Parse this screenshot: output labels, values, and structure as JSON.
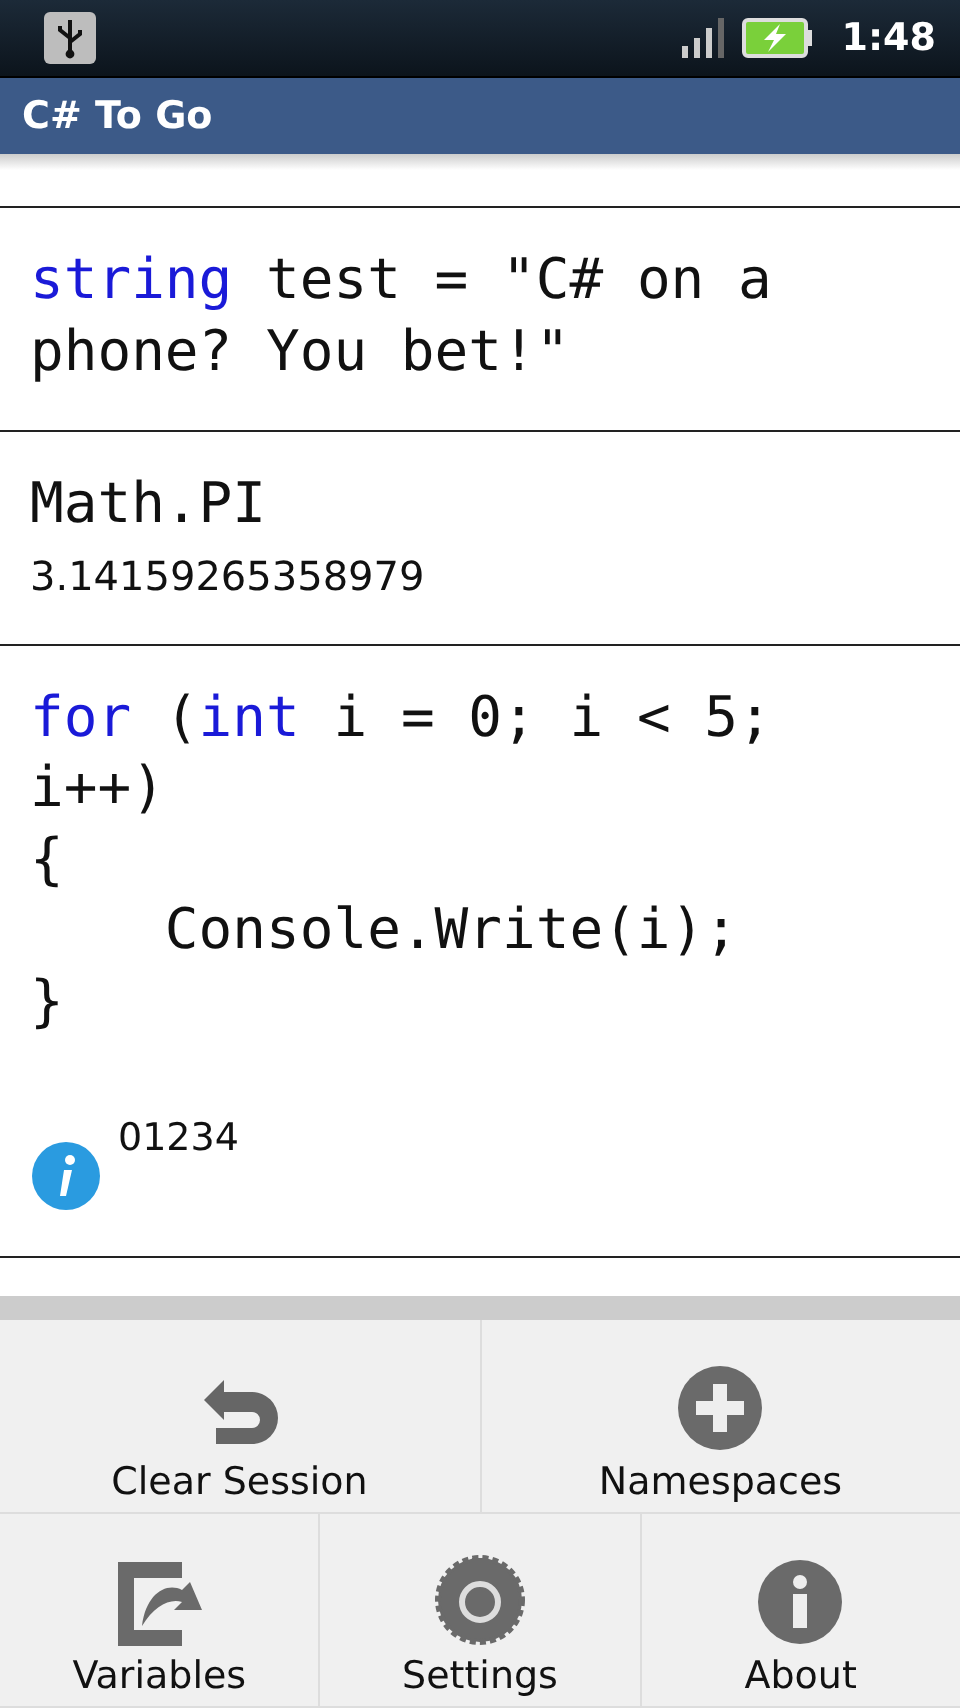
{
  "status_bar": {
    "time": "1:48"
  },
  "window": {
    "title": "C# To Go"
  },
  "entries": [
    {
      "code": [
        [
          {
            "text": "string",
            "kind": "keyword"
          },
          {
            "text": " test = \"C# on a",
            "kind": "plain"
          }
        ],
        [
          {
            "text": "phone? You bet!\"",
            "kind": "plain"
          }
        ]
      ]
    },
    {
      "code": [
        [
          {
            "text": "Math.PI",
            "kind": "plain"
          }
        ]
      ],
      "result": {
        "kind": "value",
        "text": "3.14159265358979"
      }
    },
    {
      "code": [
        [
          {
            "text": "for",
            "kind": "keyword"
          },
          {
            "text": " (",
            "kind": "plain"
          },
          {
            "text": "int",
            "kind": "keyword"
          },
          {
            "text": " i = 0; i < 5;",
            "kind": "plain"
          }
        ],
        [
          {
            "text": "i++)",
            "kind": "plain"
          }
        ],
        [
          {
            "text": "{",
            "kind": "plain"
          }
        ],
        [
          {
            "text": "    Console.Write(i);",
            "kind": "plain"
          }
        ],
        [
          {
            "text": "}",
            "kind": "plain"
          }
        ]
      ],
      "result": {
        "kind": "info",
        "text": "01234"
      }
    }
  ],
  "menu": [
    [
      {
        "label": "Clear Session",
        "kind": "undo"
      },
      {
        "label": "Namespaces",
        "kind": "plus"
      }
    ],
    [
      {
        "label": "Variables",
        "kind": "export"
      },
      {
        "label": "Settings",
        "kind": "gear"
      },
      {
        "label": "About",
        "kind": "info"
      }
    ]
  ]
}
